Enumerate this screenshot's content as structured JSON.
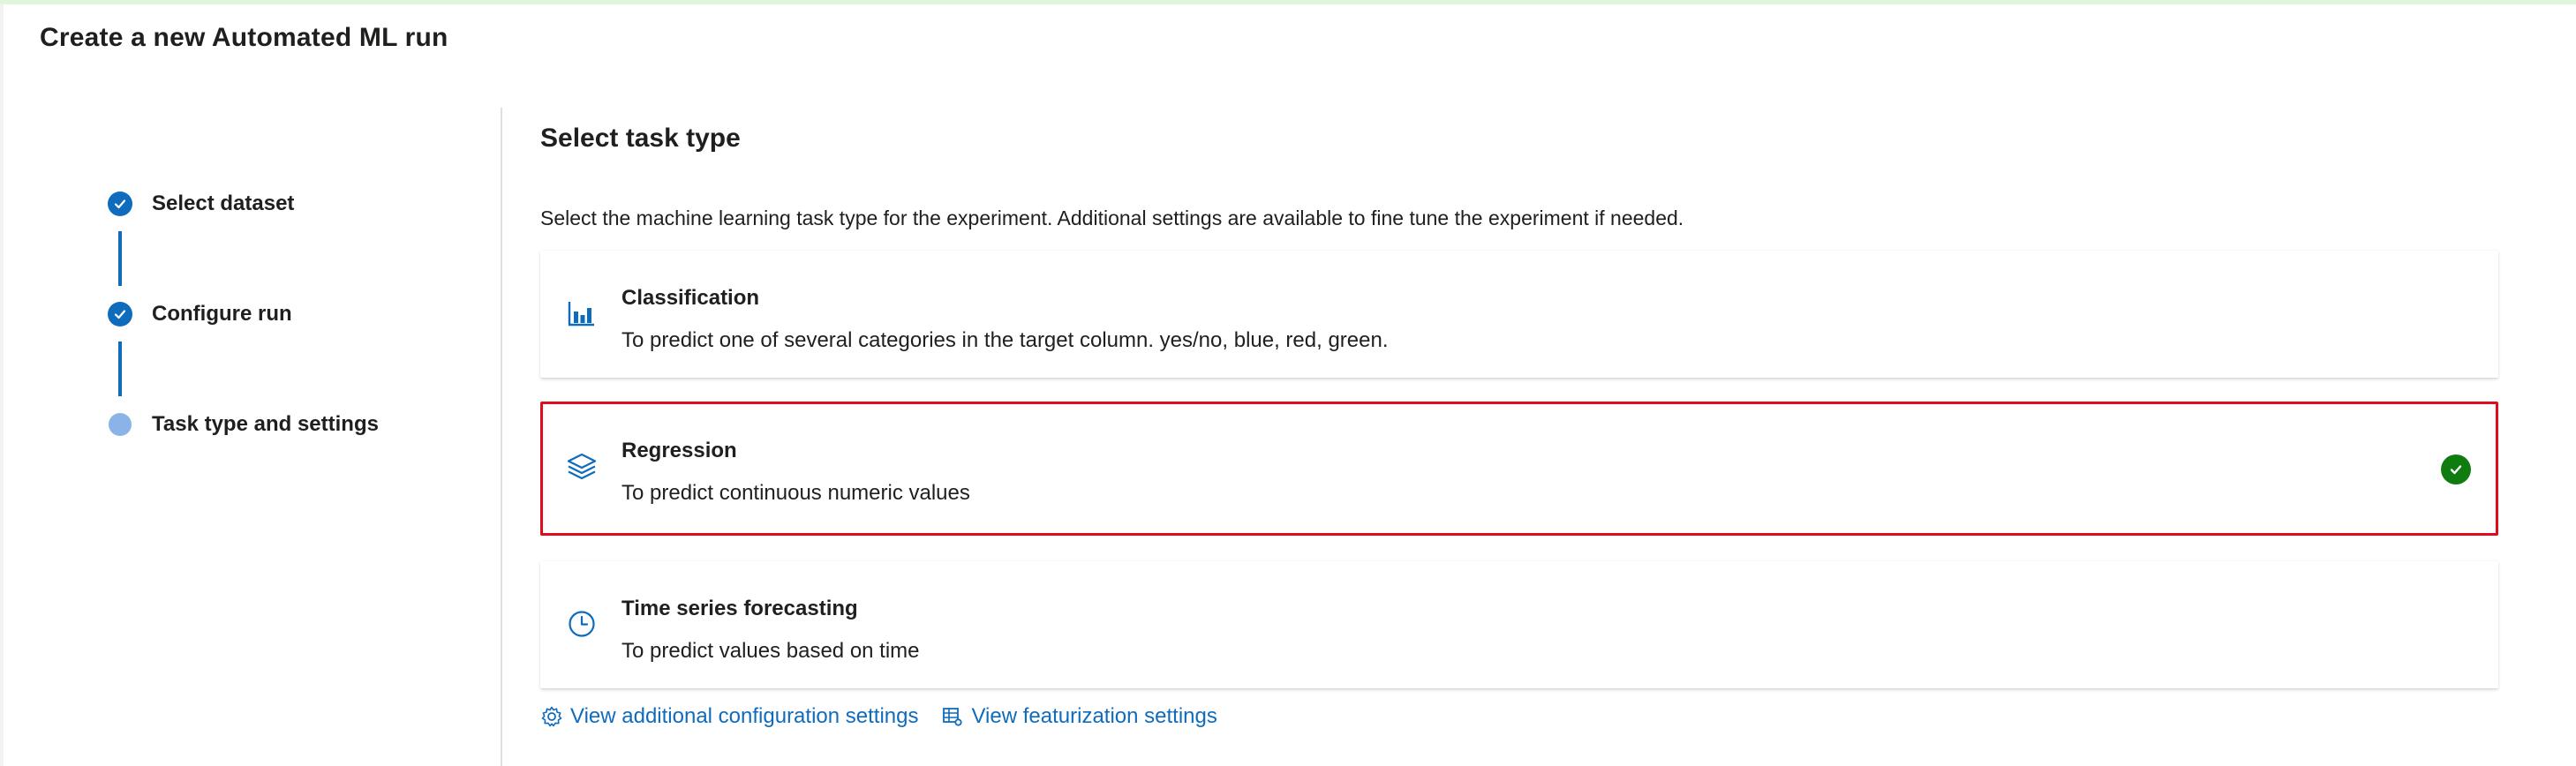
{
  "page": {
    "title": "Create a new Automated ML run"
  },
  "colors": {
    "accent": "#0f6cbd",
    "selected_border": "#e00b1c",
    "success": "#107c10",
    "current_step": "#8ab4e8"
  },
  "stepper": {
    "steps": [
      {
        "label": "Select dataset",
        "state": "completed",
        "icon": "check-icon"
      },
      {
        "label": "Configure run",
        "state": "completed",
        "icon": "check-icon"
      },
      {
        "label": "Task type and settings",
        "state": "current",
        "icon": "current-step-dot"
      }
    ]
  },
  "main": {
    "title": "Select task type",
    "description": "Select the machine learning task type for the experiment. Additional settings are available to fine tune the experiment if needed.",
    "task_types": [
      {
        "title": "Classification",
        "description": "To predict one of several categories in the target column. yes/no, blue, red, green.",
        "icon": "bar-chart-icon",
        "selected": false
      },
      {
        "title": "Regression",
        "description": "To predict continuous numeric values",
        "icon": "layers-icon",
        "selected": true
      },
      {
        "title": "Time series forecasting",
        "description": "To predict values based on time",
        "icon": "clock-icon",
        "selected": false
      }
    ],
    "links": [
      {
        "label": "View additional configuration settings",
        "icon": "gear-icon"
      },
      {
        "label": "View featurization settings",
        "icon": "table-settings-icon"
      }
    ]
  }
}
